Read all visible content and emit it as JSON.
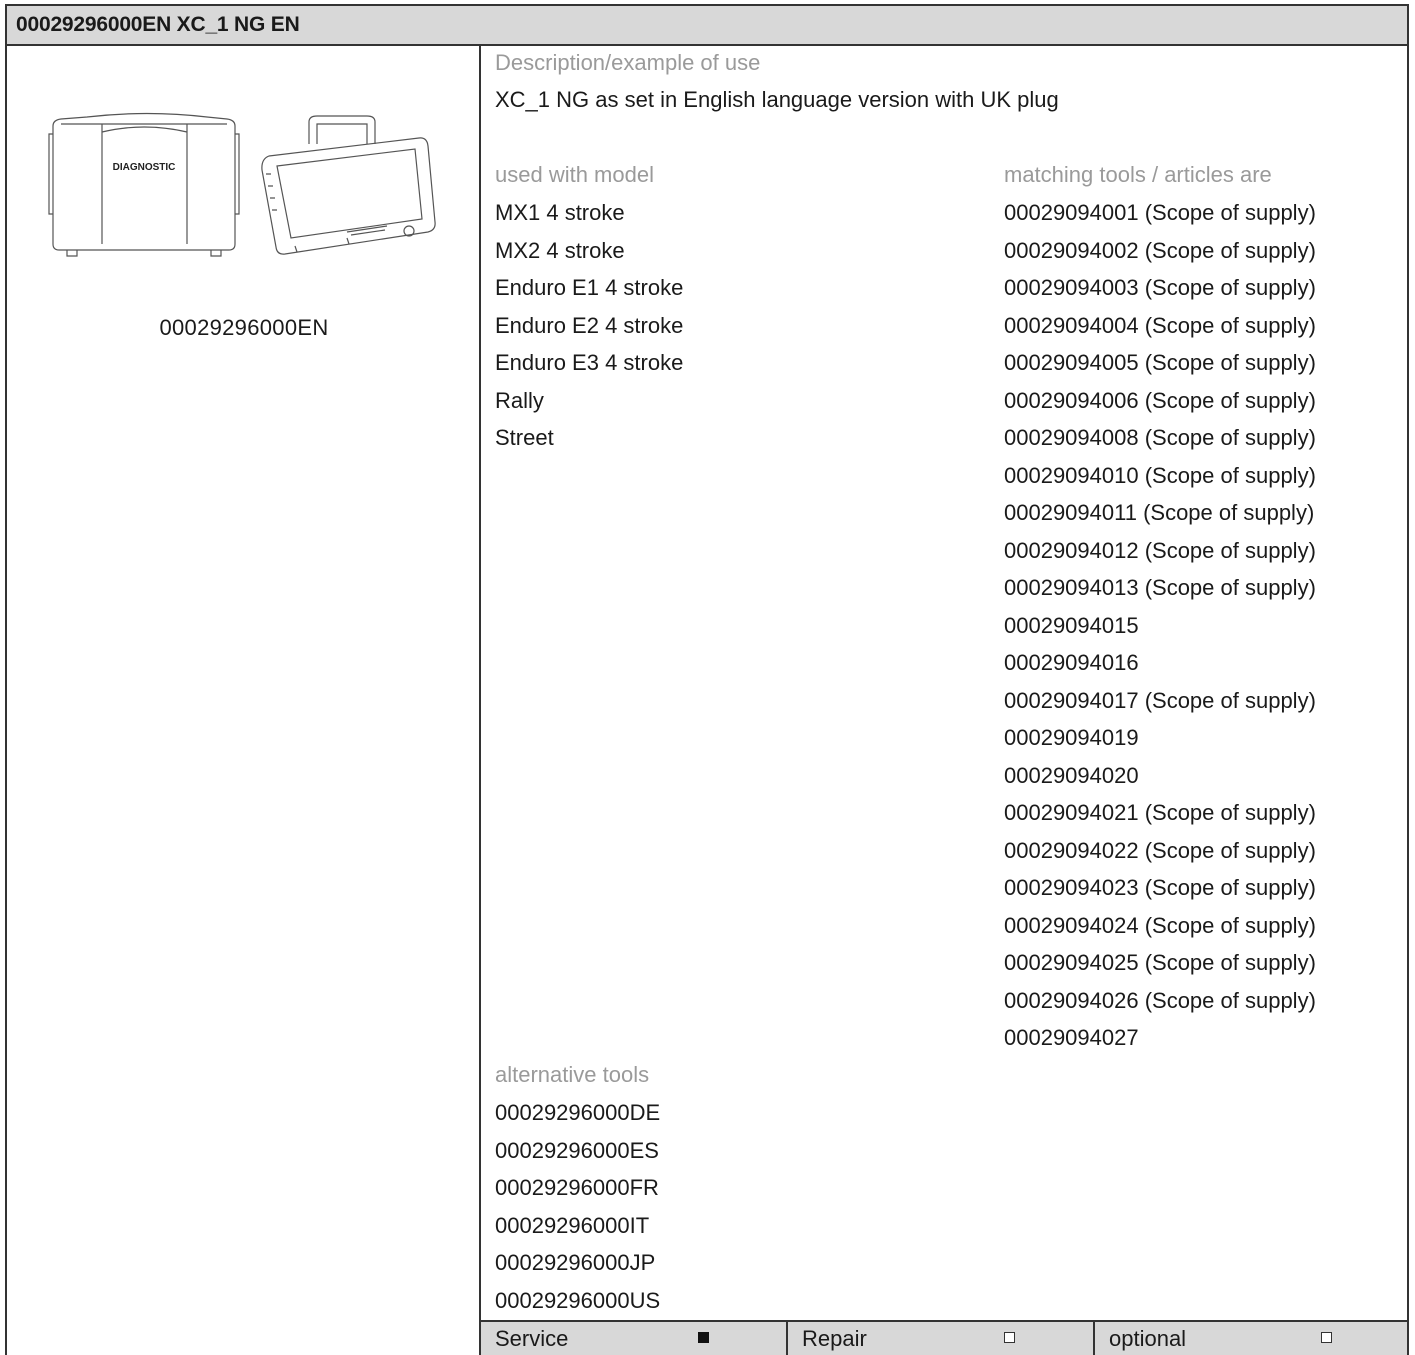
{
  "title": "00029296000EN XC_1 NG EN",
  "product": {
    "code": "00029296000EN",
    "case_lettering": "DIAGNOSTIC"
  },
  "description": {
    "label": "Description/example of use",
    "text": "XC_1 NG as set in English language version with UK plug"
  },
  "models": {
    "label": "used with model",
    "items": [
      "MX1 4 stroke",
      "MX2 4 stroke",
      "Enduro E1 4 stroke",
      "Enduro E2 4 stroke",
      "Enduro E3 4 stroke",
      "Rally",
      "Street"
    ]
  },
  "matching": {
    "label": "matching tools / articles are",
    "items": [
      "00029094001 (Scope of supply)",
      "00029094002 (Scope of supply)",
      "00029094003 (Scope of supply)",
      "00029094004 (Scope of supply)",
      "00029094005 (Scope of supply)",
      "00029094006 (Scope of supply)",
      "00029094008 (Scope of supply)",
      "00029094010 (Scope of supply)",
      "00029094011 (Scope of supply)",
      "00029094012 (Scope of supply)",
      "00029094013 (Scope of supply)",
      "00029094015",
      "00029094016",
      "00029094017 (Scope of supply)",
      "00029094019",
      "00029094020",
      "00029094021 (Scope of supply)",
      "00029094022 (Scope of supply)",
      "00029094023 (Scope of supply)",
      "00029094024 (Scope of supply)",
      "00029094025 (Scope of supply)",
      "00029094026 (Scope of supply)",
      "00029094027"
    ]
  },
  "alternatives": {
    "label": "alternative tools",
    "items": [
      "00029296000DE",
      "00029296000ES",
      "00029296000FR",
      "00029296000IT",
      "00029296000JP",
      "00029296000US"
    ]
  },
  "footer": {
    "service": {
      "label": "Service",
      "checked": true
    },
    "repair": {
      "label": "Repair",
      "checked": false
    },
    "optional": {
      "label": "optional",
      "checked": false
    }
  }
}
